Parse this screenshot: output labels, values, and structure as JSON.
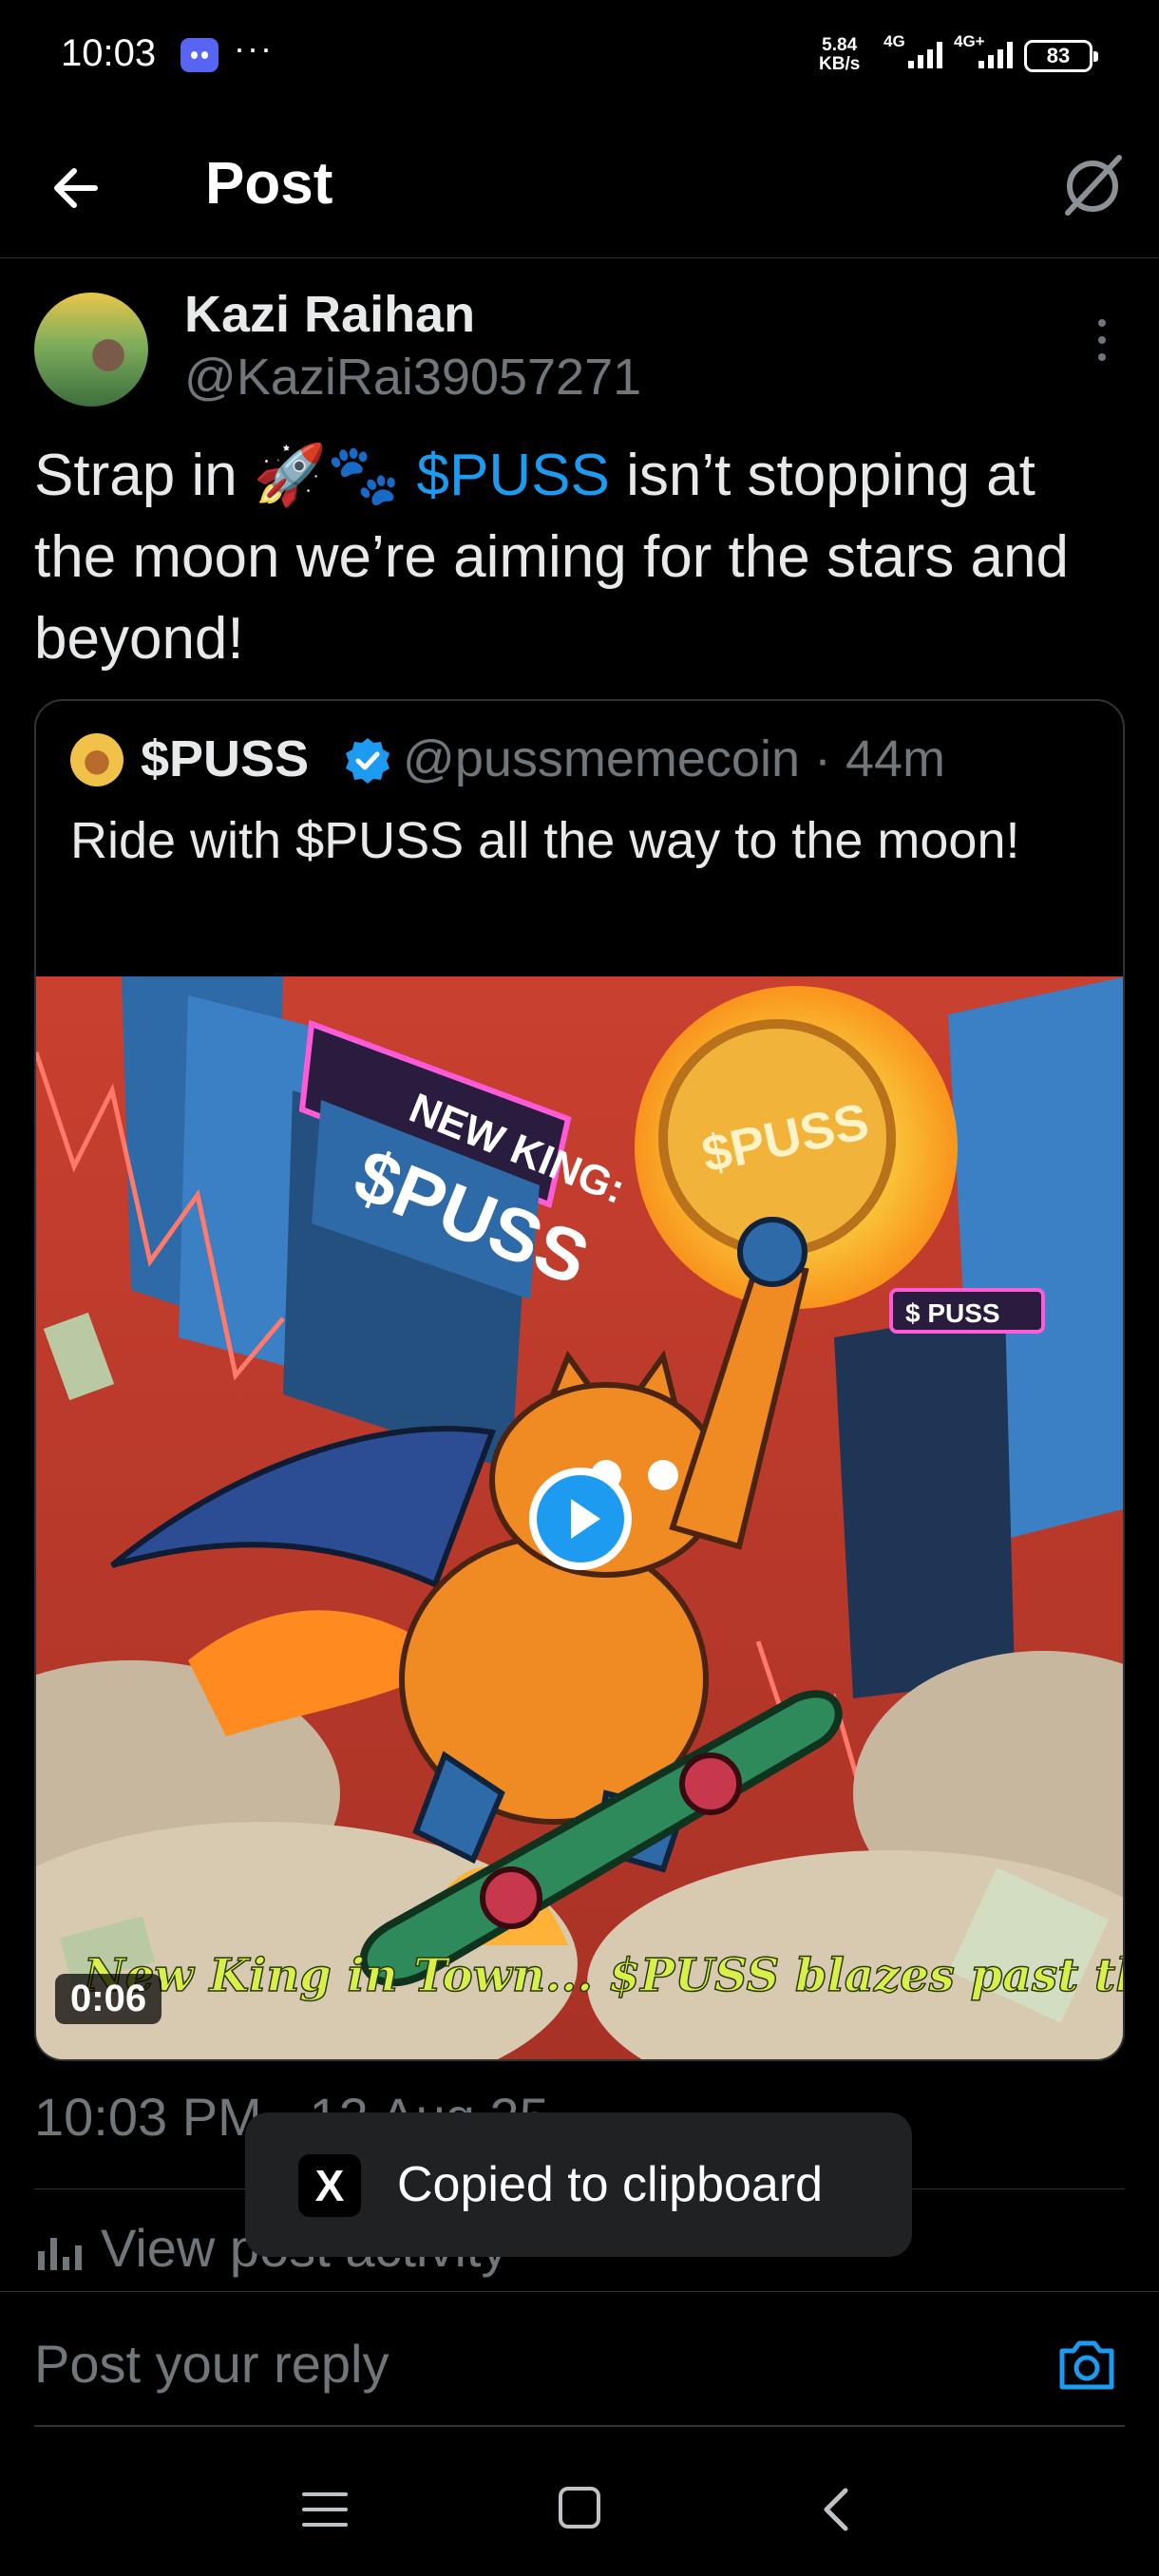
{
  "status_bar": {
    "time": "10:03",
    "more": "···",
    "net_speed": "5.84",
    "net_unit": "KB/s",
    "sim1": "4G",
    "sim2": "4G+",
    "battery": "83",
    "icons": [
      "discord-icon",
      "signal-icon",
      "battery-icon"
    ]
  },
  "header": {
    "title": "Post",
    "icons": [
      "back-arrow-icon",
      "grok-icon"
    ]
  },
  "post": {
    "author_name": "Kazi Raihan",
    "author_handle": "@KaziRai39057271",
    "text_before": "Strap in 🚀🐾 ",
    "cashtag": "$PUSS",
    "text_after": " isn’t stopping at the moon  we’re aiming for the stars and beyond!",
    "timestamp": "10:03 PM · 12 Aug 25",
    "view_activity": "View post activity"
  },
  "quote": {
    "name": "$PUSS",
    "handle": "@pussmemecoin · 44m",
    "text": "Ride with $PUSS all the way to the moon!",
    "video": {
      "duration": "0:06",
      "caption": "New King in Town... $PUSS blazes past the rest!",
      "sign_new_king": "NEW KING:",
      "sign_puss": "$PUSS",
      "coin_text": "$PUSS",
      "small_sign": "$ PUSS"
    }
  },
  "toast": {
    "logo": "X",
    "text": "Copied to clipboard"
  },
  "reply": {
    "placeholder": "Post your reply"
  },
  "colors": {
    "background": "#000000",
    "accent": "#1d9bf0",
    "text_primary": "#e7e9ea",
    "text_secondary": "#71767b",
    "border": "#2f3336"
  }
}
